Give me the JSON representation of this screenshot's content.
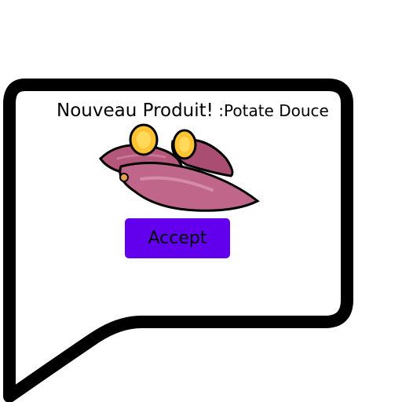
{
  "popup": {
    "title": "Nouveau Produit!",
    "separator": " :",
    "product_name": "Potate Douce",
    "product_image_icon": "sweet-potato-icon",
    "accept_label": "Accept"
  },
  "colors": {
    "bubble_border": "#000000",
    "bubble_fill": "#ffffff",
    "accept_button": "#6200ee",
    "potato_skin": "#b5577a",
    "potato_flesh": "#ffc233"
  }
}
